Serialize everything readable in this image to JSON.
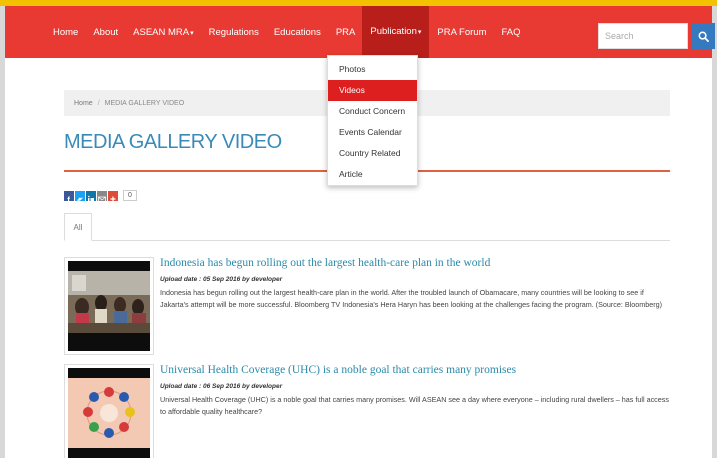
{
  "nav": {
    "items": [
      {
        "label": "Home",
        "active": false
      },
      {
        "label": "About",
        "active": false
      },
      {
        "label": "ASEAN MRA",
        "active": false,
        "has_caret": true
      },
      {
        "label": "Regulations",
        "active": false
      },
      {
        "label": "Educations",
        "active": false
      },
      {
        "label": "PRA",
        "active": false
      },
      {
        "label": "Publication",
        "active": true,
        "has_caret": true
      },
      {
        "label": "PRA Forum",
        "active": false
      },
      {
        "label": "FAQ",
        "active": false
      }
    ],
    "caret": "▾",
    "search_placeholder": "Search",
    "search_icon": "search-icon",
    "bar_color": "#e83a33",
    "active_color": "#b81e1a"
  },
  "dropdown": {
    "items": [
      {
        "label": "Photos",
        "active": false
      },
      {
        "label": "Videos",
        "active": true
      },
      {
        "label": "Conduct Concern",
        "active": false
      },
      {
        "label": "Events Calendar",
        "active": false
      },
      {
        "label": "Country Related",
        "active": false
      },
      {
        "label": "Article",
        "active": false
      }
    ],
    "highlight_color": "#dd1f1f"
  },
  "breadcrumb": {
    "home": "Home",
    "separator": "/",
    "current": "MEDIA GALLERY VIDEO"
  },
  "page": {
    "title": "MEDIA GALLERY VIDEO",
    "title_color": "#3a8ab8"
  },
  "share": {
    "buttons": [
      {
        "icon": "facebook-icon",
        "color": "#3b5998"
      },
      {
        "icon": "twitter-icon",
        "color": "#1da1f2"
      },
      {
        "icon": "linkedin-icon",
        "color": "#0e76a8"
      },
      {
        "icon": "email-icon",
        "color": "#888888"
      },
      {
        "icon": "google-plus-icon",
        "color": "#dd4b39"
      }
    ],
    "count": "0"
  },
  "tabs": {
    "all": "All"
  },
  "videos": [
    {
      "title": "Indonesia has begun rolling out the largest health-care plan in the world",
      "upload": "Upload date : 05 Sep 2016 by developer",
      "description": "Indonesia has begun rolling out the largest health-care plan in the world. After the troubled launch of Obamacare, many countries will be looking to see if Jakarta's attempt will be more successful. Bloomberg TV Indonesia's Hera Haryn has been looking at the challenges facing the program. (Source: Bloomberg)"
    },
    {
      "title": "Universal Health Coverage (UHC) is a noble goal that carries many promises",
      "upload": "Upload date : 06 Sep 2016 by developer",
      "description": "Universal Health Coverage (UHC) is a noble goal that carries many promises. Will ASEAN see a day where everyone – including rural dwellers – has full access to affordable quality healthcare?"
    }
  ]
}
